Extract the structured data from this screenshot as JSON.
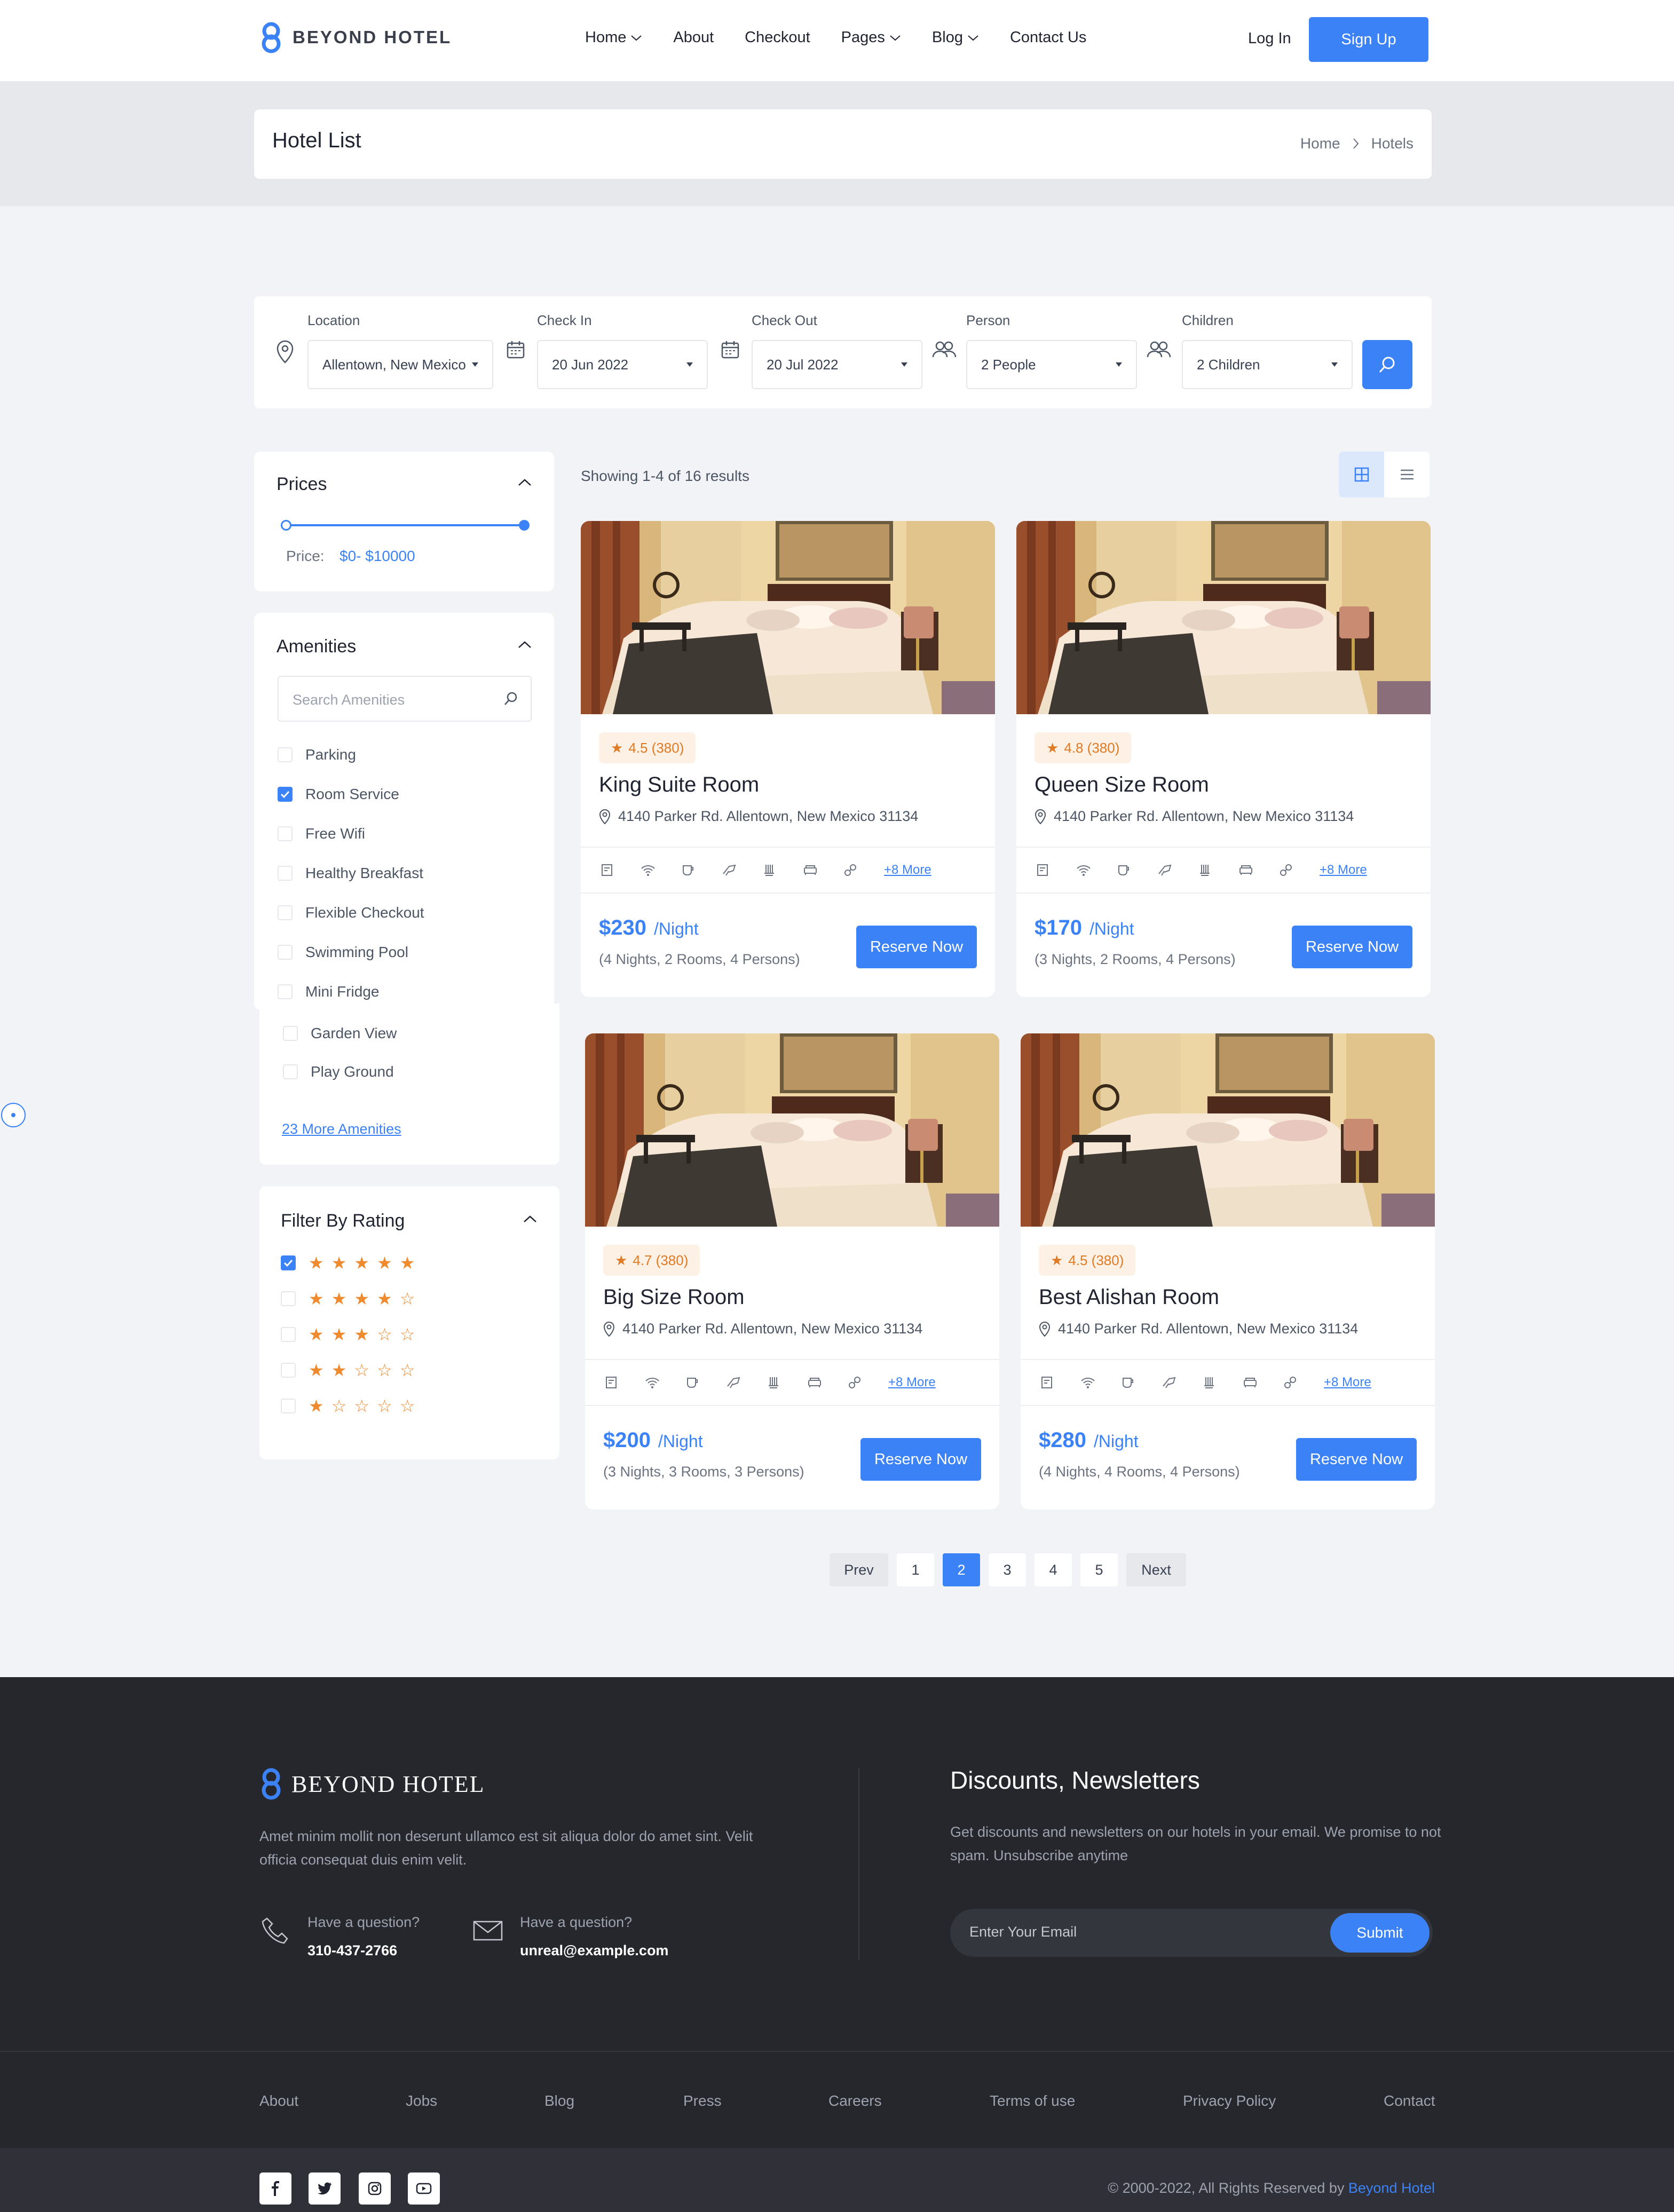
{
  "header": {
    "logo_text": "BEYOND HOTEL",
    "nav": [
      {
        "label": "Home",
        "has_dropdown": true
      },
      {
        "label": "About",
        "has_dropdown": false
      },
      {
        "label": "Checkout",
        "has_dropdown": false
      },
      {
        "label": "Pages",
        "has_dropdown": true
      },
      {
        "label": "Blog",
        "has_dropdown": true
      },
      {
        "label": "Contact Us",
        "has_dropdown": false
      }
    ],
    "login_label": "Log In",
    "signup_label": "Sign Up"
  },
  "page": {
    "title": "Hotel List",
    "breadcrumb": [
      "Home",
      "Hotels"
    ]
  },
  "search": {
    "location": {
      "label": "Location",
      "value": "Allentown, New Mexico",
      "icon": "map-pin-icon"
    },
    "checkin": {
      "label": "Check In",
      "value": "20 Jun 2022",
      "icon": "calendar-icon"
    },
    "checkout": {
      "label": "Check Out",
      "value": "20 Jul 2022",
      "icon": "calendar-icon"
    },
    "person": {
      "label": "Person",
      "value": "2 People",
      "icon": "users-icon"
    },
    "children": {
      "label": "Children",
      "value": "2 Children",
      "icon": "users-icon"
    },
    "button_icon": "search-icon"
  },
  "filters": {
    "prices": {
      "title": "Prices",
      "label": "Price:",
      "range": "$0- $10000",
      "min_fraction": 0.0,
      "max_fraction": 1.0
    },
    "amenities": {
      "title": "Amenities",
      "search_placeholder": "Search Amenities",
      "items": [
        {
          "label": "Parking",
          "checked": false
        },
        {
          "label": "Room Service",
          "checked": true
        },
        {
          "label": "Free Wifi",
          "checked": false
        },
        {
          "label": "Healthy Breakfast",
          "checked": false
        },
        {
          "label": "Flexible Checkout",
          "checked": false
        },
        {
          "label": "Swimming Pool",
          "checked": false
        },
        {
          "label": "Mini Fridge",
          "checked": false
        },
        {
          "label": "Garden View",
          "checked": false
        },
        {
          "label": "Play Ground",
          "checked": false
        }
      ],
      "more_link": "23 More Amenities"
    },
    "rating": {
      "title": "Filter By Rating",
      "options": [
        {
          "stars": 5,
          "checked": true
        },
        {
          "stars": 4,
          "checked": false
        },
        {
          "stars": 3,
          "checked": false
        },
        {
          "stars": 2,
          "checked": false
        },
        {
          "stars": 1,
          "checked": false
        }
      ]
    }
  },
  "results": {
    "showing": "Showing 1-4 of 16 results",
    "view_modes": [
      "grid-view-icon",
      "list-view-icon"
    ],
    "active_view": "grid",
    "hotels": [
      {
        "rating": "4.5 (380)",
        "name": "King Suite Room",
        "address": "4140 Parker Rd. Allentown, New Mexico 31134",
        "more": "+8 More",
        "price": "$230",
        "per": "/Night",
        "details": "(4 Nights, 2 Rooms, 4 Persons)",
        "cta": "Reserve Now"
      },
      {
        "rating": "4.8 (380)",
        "name": "Queen Size Room",
        "address": "4140 Parker Rd. Allentown, New Mexico 31134",
        "more": "+8 More",
        "price": "$170",
        "per": "/Night",
        "details": "(3 Nights, 2 Rooms, 4 Persons)",
        "cta": "Reserve Now"
      },
      {
        "rating": "4.7 (380)",
        "name": "Big Size Room",
        "address": "4140 Parker Rd. Allentown, New Mexico 31134",
        "more": "+8 More",
        "price": "$200",
        "per": "/Night",
        "details": "(3 Nights, 3 Rooms, 3 Persons)",
        "cta": "Reserve Now"
      },
      {
        "rating": "4.5 (380)",
        "name": "Best Alishan Room",
        "address": "4140 Parker Rd. Allentown, New Mexico 31134",
        "more": "+8 More",
        "price": "$280",
        "per": "/Night",
        "details": "(4 Nights, 4 Rooms, 4 Persons)",
        "cta": "Reserve Now"
      }
    ],
    "amenity_icons": [
      "document-icon",
      "wifi-icon",
      "cup-icon",
      "hairdryer-icon",
      "heater-icon",
      "sofa-icon",
      "link-icon"
    ]
  },
  "pagination": {
    "prev": "Prev",
    "pages": [
      "1",
      "2",
      "3",
      "4",
      "5"
    ],
    "current": "2",
    "next": "Next"
  },
  "footer": {
    "logo_text": "BEYOND HOTEL",
    "description": "Amet minim mollit non deserunt ullamco est sit aliqua dolor do amet sint. Velit officia consequat duis enim velit.",
    "phone": {
      "question": "Have a question?",
      "value": "310-437-2766"
    },
    "email": {
      "question": "Have a question?",
      "value": "unreal@example.com"
    },
    "newsletter": {
      "title": "Discounts, Newsletters",
      "description": "Get discounts and newsletters on our hotels in your email. We promise to not spam. Unsubscribe anytime",
      "placeholder": "Enter Your Email",
      "button": "Submit"
    },
    "links": [
      "About",
      "Jobs",
      "Blog",
      "Press",
      "Careers",
      "Terms of use",
      "Privacy Policy",
      "Contact"
    ],
    "social": [
      "facebook-icon",
      "twitter-icon",
      "instagram-icon",
      "youtube-icon"
    ],
    "copyright": "© 2000-2022, All Rights Reserved by",
    "copyright_brand": "Beyond Hotel"
  },
  "colors": {
    "accent": "#3b82f6",
    "star": "#f08a2e",
    "footer_bg": "#26272d",
    "page_bg": "#f2f3f6"
  }
}
